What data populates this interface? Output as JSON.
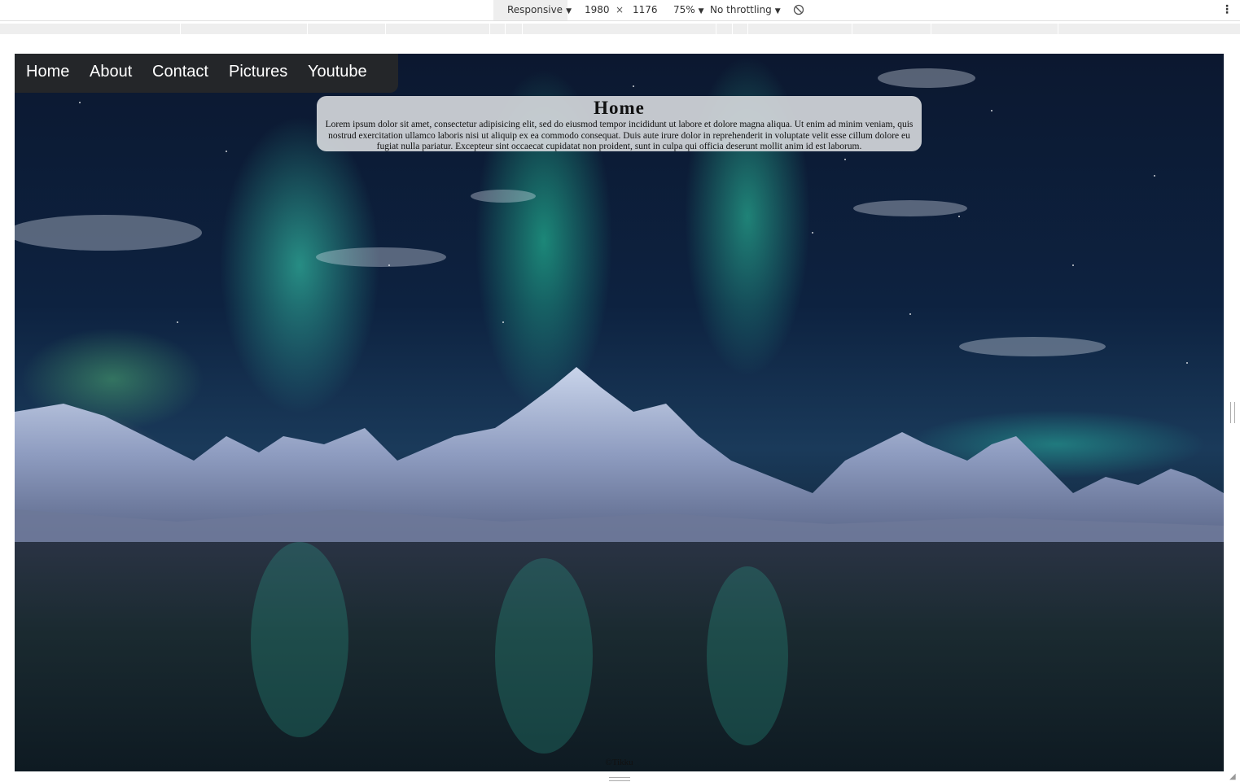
{
  "devtools": {
    "device": "Responsive",
    "width": "1980",
    "times": "×",
    "height": "1176",
    "zoom": "75%",
    "throttling": "No throttling",
    "rotate_icon": "rotate-icon",
    "more_icon": "more-vertical-icon"
  },
  "nav": {
    "items": [
      "Home",
      "About",
      "Contact",
      "Pictures",
      "Youtube"
    ]
  },
  "main": {
    "title": "Home",
    "body": "Lorem ipsum dolor sit amet, consectetur adipisicing elit, sed do eiusmod tempor incididunt ut labore et dolore magna aliqua. Ut enim ad minim veniam, quis nostrud exercitation ullamco laboris nisi ut aliquip ex ea commodo consequat. Duis aute irure dolor in reprehenderit in voluptate velit esse cillum dolore eu fugiat nulla pariatur. Excepteur sint occaecat cupidatat non proident, sunt in culpa qui officia deserunt mollit anim id est laborum."
  },
  "footer": {
    "text": "©Tikku"
  },
  "colors": {
    "navbar_bg": "#282828",
    "card_bg": "#d7dade",
    "aurora": "#2ee0b0"
  }
}
